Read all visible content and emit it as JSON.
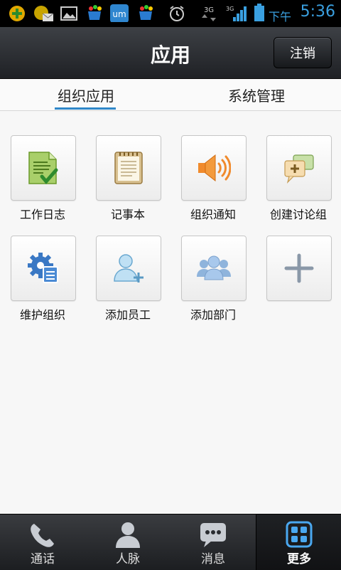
{
  "status_bar": {
    "ampm": "下午",
    "time": "5:36",
    "network": "3G"
  },
  "header": {
    "title": "应用",
    "logout_label": "注销"
  },
  "tabs": [
    {
      "label": "组织应用",
      "active": true
    },
    {
      "label": "系统管理",
      "active": false
    }
  ],
  "apps": [
    {
      "label": "工作日志",
      "icon": "worklog-icon"
    },
    {
      "label": "记事本",
      "icon": "notepad-icon"
    },
    {
      "label": "组织通知",
      "icon": "speaker-icon"
    },
    {
      "label": "创建讨论组",
      "icon": "chat-add-icon"
    },
    {
      "label": "维护组织",
      "icon": "gear-list-icon"
    },
    {
      "label": "添加员工",
      "icon": "add-user-icon"
    },
    {
      "label": "添加部门",
      "icon": "group-icon"
    },
    {
      "label": "",
      "icon": "plus-icon"
    }
  ],
  "bottom_nav": [
    {
      "label": "通话",
      "icon": "phone-icon"
    },
    {
      "label": "人脉",
      "icon": "contacts-icon"
    },
    {
      "label": "消息",
      "icon": "message-icon"
    },
    {
      "label": "更多",
      "icon": "more-grid-icon",
      "active": true
    }
  ],
  "colors": {
    "accent": "#2f87c9",
    "time": "#3aa0e0"
  }
}
